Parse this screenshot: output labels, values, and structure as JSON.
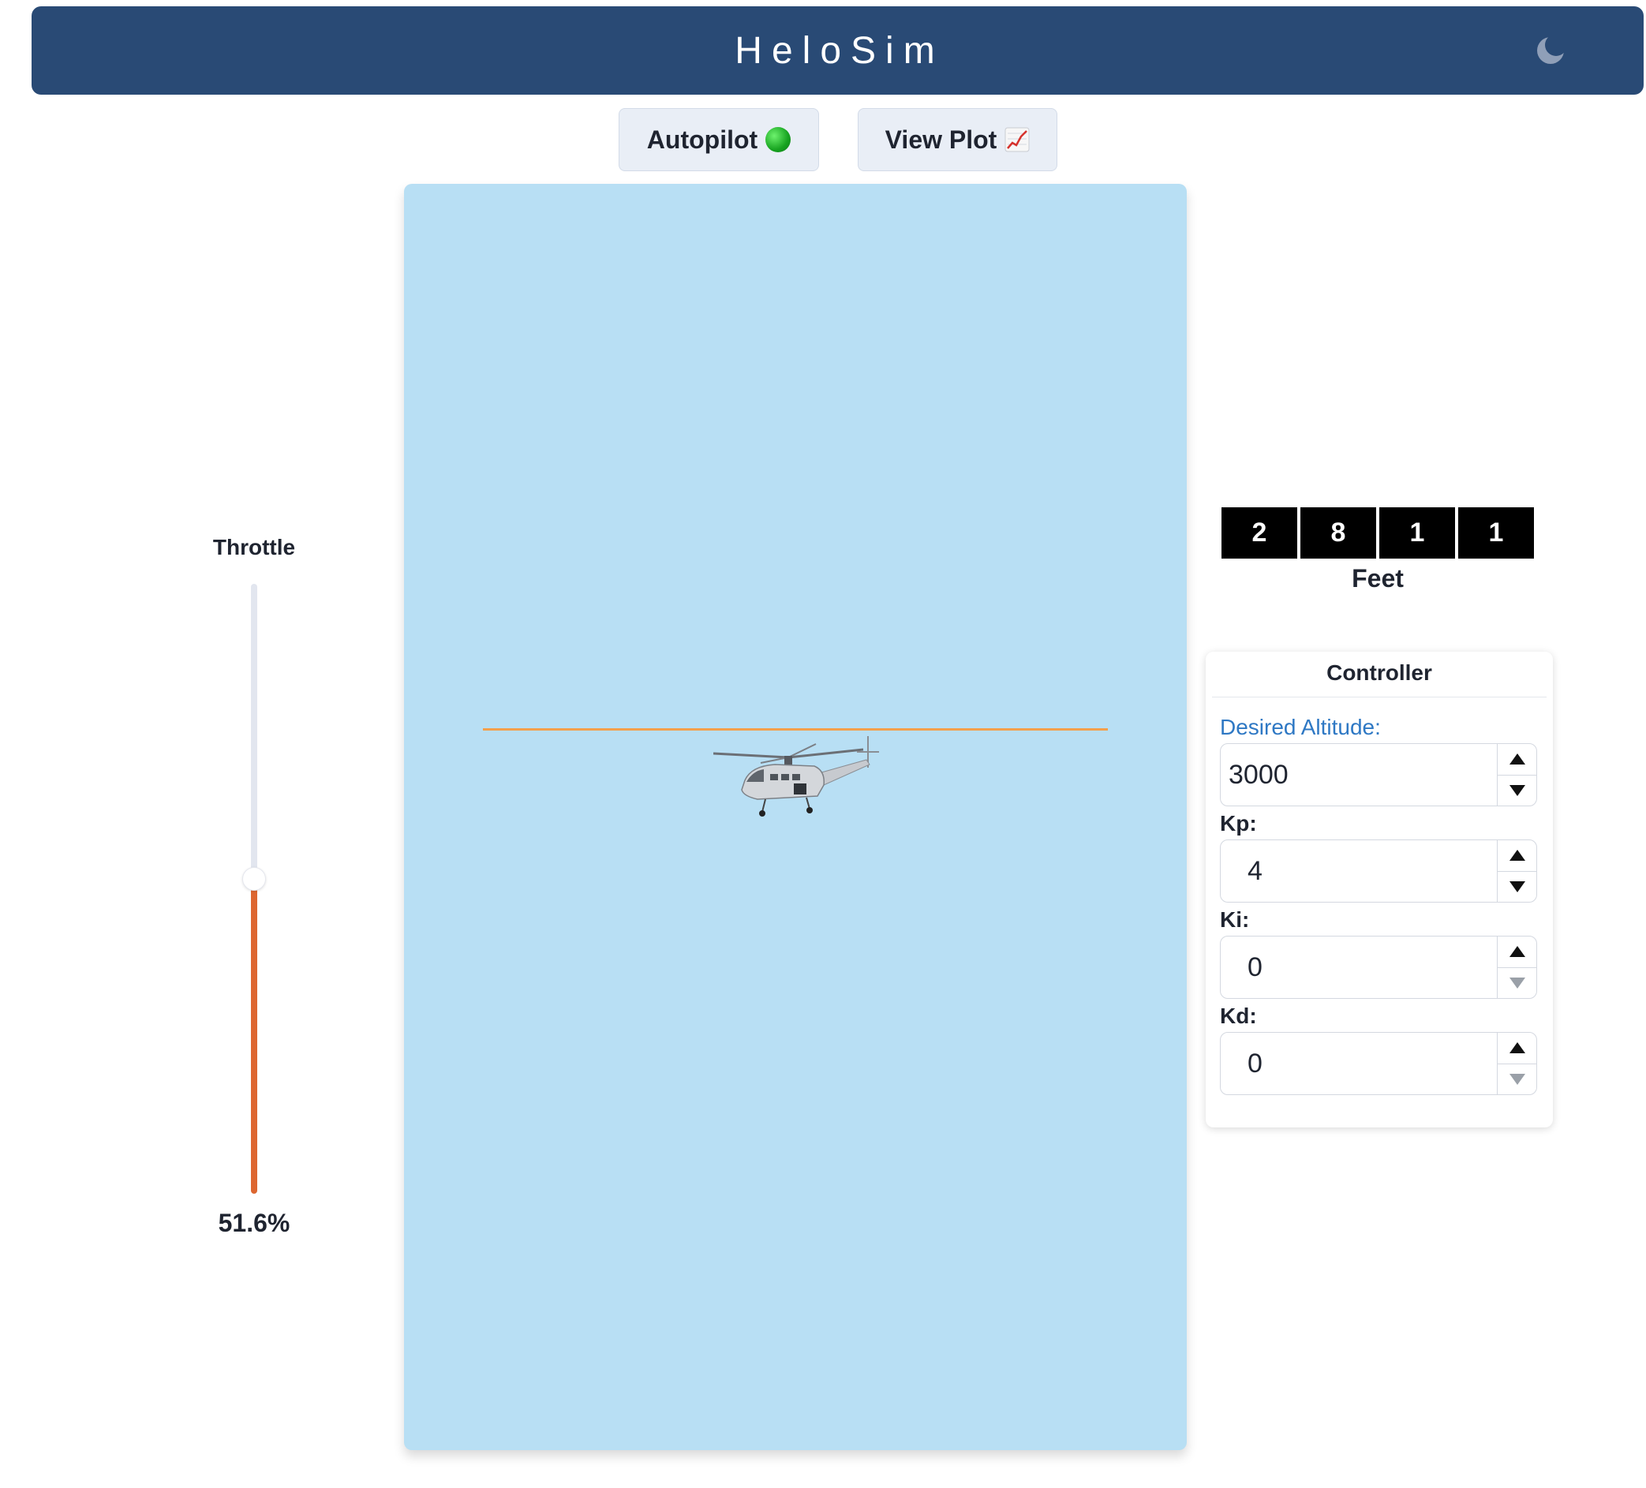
{
  "app": {
    "title": "HeloSim",
    "theme_toggle_icon": "moon-icon"
  },
  "toolbar": {
    "autopilot_label": "Autopilot",
    "autopilot_status_icon": "green-circle-icon",
    "autopilot_status_color": "#17a320",
    "view_plot_label": "View Plot",
    "view_plot_icon": "chart-increasing-icon"
  },
  "throttle": {
    "label": "Throttle",
    "value_text": "51.6%",
    "level_percent": 51.6,
    "fill_color": "#dd6630"
  },
  "sky": {
    "background_color": "#b8dff4",
    "target_line_color": "#f3a04c",
    "vehicle_icon": "helicopter-icon"
  },
  "altimeter": {
    "digits": [
      "2",
      "8",
      "1",
      "1"
    ],
    "unit": "Feet"
  },
  "controller": {
    "title": "Controller",
    "desired_altitude": {
      "label": "Desired Altitude:",
      "value": "3000"
    },
    "kp": {
      "label": "Kp:",
      "value": "4"
    },
    "ki": {
      "label": "Ki:",
      "value": "0"
    },
    "kd": {
      "label": "Kd:",
      "value": "0"
    }
  }
}
